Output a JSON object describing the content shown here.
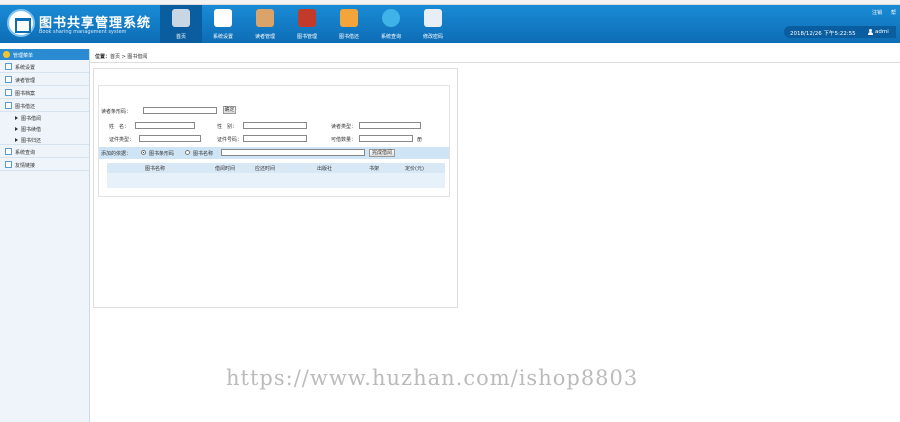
{
  "header": {
    "title": "图书共享管理系统",
    "subtitle": "Book sharing management system",
    "nav": [
      {
        "label": "首页",
        "icon": "printer-icon",
        "color": "#c9d6e3"
      },
      {
        "label": "系统设置",
        "icon": "tools-icon",
        "color": "#ffffff"
      },
      {
        "label": "读者管理",
        "icon": "readers-icon",
        "color": "#d9a36a"
      },
      {
        "label": "图书管理",
        "icon": "book-icon",
        "color": "#c23b2a"
      },
      {
        "label": "图书借还",
        "icon": "chart-icon",
        "color": "#f3a43a"
      },
      {
        "label": "系统查询",
        "icon": "search-icon",
        "color": "#3fb3e8"
      },
      {
        "label": "修改密码",
        "icon": "pen-icon",
        "color": "#e8eef5"
      }
    ],
    "logout": "注销",
    "help": "帮",
    "date": "2018/12/26 下午5:22:55",
    "user": "admi"
  },
  "sidebar": {
    "heading": "管理菜单",
    "items": [
      {
        "label": "系统设置",
        "type": "item"
      },
      {
        "label": "读者管理",
        "type": "item"
      },
      {
        "label": "图书档案",
        "type": "item"
      },
      {
        "label": "图书借还",
        "type": "item"
      },
      {
        "label": "图书借阅",
        "type": "sub"
      },
      {
        "label": "图书续借",
        "type": "sub"
      },
      {
        "label": "图书归还",
        "type": "sub"
      },
      {
        "label": "系统查询",
        "type": "item"
      },
      {
        "label": "友情链接",
        "type": "item"
      }
    ]
  },
  "breadcrumb": {
    "prefix": "位置：",
    "path": "首页 > 图书借阅"
  },
  "form": {
    "reader_barcode_label": "读者条形码：",
    "confirm_label": "确定",
    "name_label": "姓　名：",
    "sex_label": "性　别：",
    "reader_type_label": "读者类型：",
    "id_type_label": "证件类型：",
    "id_number_label": "证件号码：",
    "can_borrow_label": "可借数量：",
    "unit": "册",
    "add_basis_label": "添加的依据：",
    "radio_barcode": "图书条形码",
    "radio_name": "图书名称",
    "finish_button": "完成借阅",
    "columns": [
      "图书名称",
      "借阅时间",
      "应还时间",
      "出版社",
      "书架",
      "定价(元)"
    ]
  },
  "watermark": "https://www.huzhan.com/ishop8803"
}
